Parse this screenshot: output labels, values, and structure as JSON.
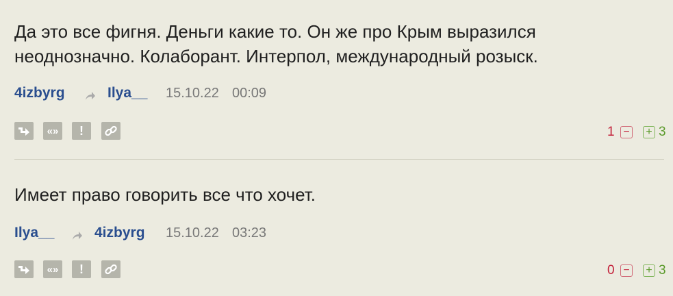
{
  "comments": [
    {
      "text_line1": "Да это все фигня. Деньги какие то. Он же про Крым выразился",
      "text_line2": "неоднозначно. Колаборант. Интерпол, международный розыск.",
      "author": "4izbyrg",
      "reply_to": "Ilya__",
      "date": "15.10.22",
      "time": "00:09",
      "rating_negative": "1",
      "rating_positive": "3"
    },
    {
      "text_line1": "Имеет право говорить все что хочет.",
      "author": "Ilya__",
      "reply_to": "4izbyrg",
      "date": "15.10.22",
      "time": "03:23",
      "rating_negative": "0",
      "rating_positive": "3"
    }
  ],
  "actions": [
    "reply-icon",
    "quote-icon",
    "report-icon",
    "link-icon"
  ],
  "vote": {
    "minus": "−",
    "plus": "+"
  },
  "colors": {
    "background": "#ecebe0",
    "author": "#2a4e8f",
    "negative": "#c3213a",
    "positive": "#5a9a2a",
    "icon_bg": "#b5b5ab"
  }
}
